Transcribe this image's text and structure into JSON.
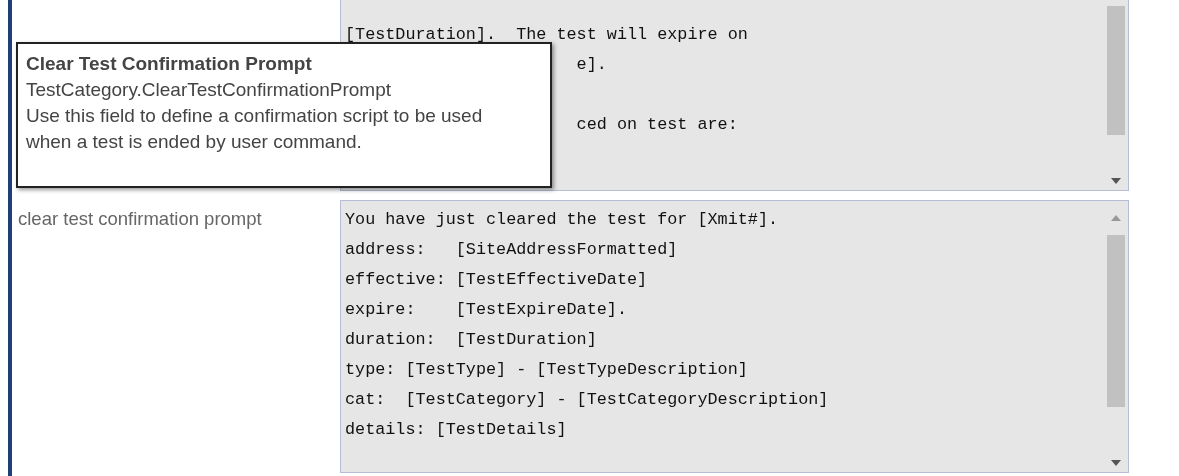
{
  "upper_prompt": {
    "lines": [
      {
        "kind": "text",
        "text": "[TestDuration].  The test will expire on",
        "covered": false
      },
      {
        "kind": "text",
        "text": "e].",
        "covered": true
      },
      {
        "kind": "blank"
      },
      {
        "kind": "text",
        "text": "ced on test are:",
        "covered": true
      }
    ]
  },
  "tooltip": {
    "title": "Clear Test Confirmation Prompt",
    "field": "TestCategory.ClearTestConfirmationPrompt",
    "description": "Use this field to define a confirmation script to be used when a test is ended by user command."
  },
  "clear_prompt": {
    "label": "clear test confirmation prompt",
    "lines": [
      "You have just cleared the test for [Xmit#].",
      "address:   [SiteAddressFormatted]",
      "effective: [TestEffectiveDate]",
      "expire:    [TestExpireDate].",
      "duration:  [TestDuration]",
      "type: [TestType] - [TestTypeDescription]",
      "cat:  [TestCategory] - [TestCategoryDescription]",
      "details: [TestDetails]"
    ]
  }
}
